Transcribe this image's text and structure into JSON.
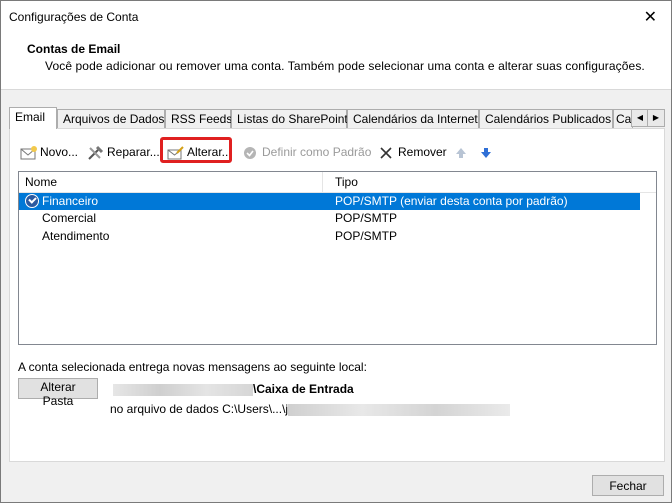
{
  "window": {
    "title": "Configurações de Conta",
    "close_glyph": "✕"
  },
  "header": {
    "section_title": "Contas de Email",
    "description": "Você pode adicionar ou remover uma conta. Também pode selecionar uma conta e alterar suas configurações."
  },
  "tabs": [
    {
      "label": "Email",
      "active": true
    },
    {
      "label": "Arquivos de Dados"
    },
    {
      "label": "RSS Feeds"
    },
    {
      "label": "Listas do SharePoint"
    },
    {
      "label": "Calendários da Internet"
    },
    {
      "label": "Calendários Publicados"
    },
    {
      "label": "Ca"
    }
  ],
  "toolbar": {
    "new_label": "Novo...",
    "repair_label": "Reparar...",
    "change_label": "Alterar...",
    "set_default_label": "Definir como Padrão",
    "remove_label": "Remover"
  },
  "accounts": {
    "headers": {
      "name": "Nome",
      "type": "Tipo"
    },
    "rows": [
      {
        "name": "Financeiro",
        "type": "POP/SMTP (enviar desta conta por padrão)",
        "selected": true
      },
      {
        "name": "Comercial",
        "type": "POP/SMTP"
      },
      {
        "name": "Atendimento",
        "type": "POP/SMTP"
      }
    ]
  },
  "delivery": {
    "text": "A conta selecionada entrega novas mensagens ao seguinte local:",
    "change_folder_label": "Alterar Pasta",
    "inbox_suffix": "\\Caixa de Entrada",
    "data_file_prefix": "no arquivo de dados C:\\Users\\...\\j"
  },
  "footer": {
    "close_label": "Fechar"
  },
  "colors": {
    "selection": "#0078d7",
    "highlight": "#e02020"
  }
}
